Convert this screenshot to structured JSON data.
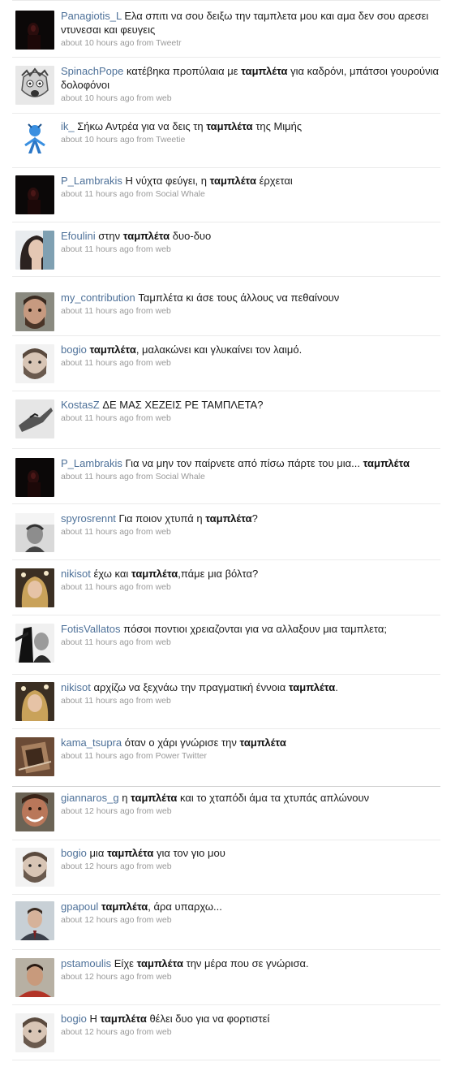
{
  "tweets": [
    {
      "user": "Panagiotis_L",
      "parts": [
        {
          "t": "Ελα σπιτι να σου δειξω την ταμπλετα μου και αμα δεν σου αρεσει ντυνεσαι και φευγεις",
          "b": false
        }
      ],
      "time": "about 10 hours ago",
      "source": "Tweetr",
      "avatar": "dark-figure-icon"
    },
    {
      "user": "SpinachPope",
      "parts": [
        {
          "t": "κατέβηκα προπύλαια με ",
          "b": false
        },
        {
          "t": "ταμπλέτα",
          "b": true
        },
        {
          "t": " για καδρόνι, μπάτσοι γουρούνια δολοφόνοι",
          "b": false
        }
      ],
      "time": "about 10 hours ago",
      "source": "web",
      "avatar": "cartoon-face-icon"
    },
    {
      "user": "ik_",
      "parts": [
        {
          "t": "Σήκω Αντρέα για να δεις τη ",
          "b": false
        },
        {
          "t": "ταμπλέτα",
          "b": true
        },
        {
          "t": " της Μιμής",
          "b": false
        }
      ],
      "time": "about 10 hours ago",
      "source": "Tweetie",
      "avatar": "blue-figure-icon"
    },
    {
      "user": "P_Lambrakis",
      "parts": [
        {
          "t": "Η νύχτα φεύγει, η ",
          "b": false
        },
        {
          "t": "ταμπλέτα",
          "b": true
        },
        {
          "t": " έρχεται",
          "b": false
        }
      ],
      "time": "about 11 hours ago",
      "source": "Social Whale",
      "avatar": "dark-figure-icon"
    },
    {
      "user": "Efoulini",
      "parts": [
        {
          "t": "στην ",
          "b": false
        },
        {
          "t": "ταμπλέτα",
          "b": true
        },
        {
          "t": " δυο-δυο",
          "b": false
        }
      ],
      "time": "about 11 hours ago",
      "source": "web",
      "avatar": "woman-portrait-icon"
    },
    {
      "user": "my_contribution",
      "parts": [
        {
          "t": "Ταμπλέτα κι άσε τους άλλους να πεθαίνουν",
          "b": false
        }
      ],
      "time": "about 11 hours ago",
      "source": "web",
      "avatar": "man-portrait-icon"
    },
    {
      "user": "bogio",
      "parts": [
        {
          "t": "ταμπλέτα",
          "b": true
        },
        {
          "t": ", μαλακώνει και γλυκαίνει τον λαιμό.",
          "b": false
        }
      ],
      "time": "about 11 hours ago",
      "source": "web",
      "avatar": "bearded-man-icon"
    },
    {
      "user": "KostasZ",
      "parts": [
        {
          "t": "ΔΕ ΜΑΣ ΧΕΖΕΙΣ ΡΕ ΤΑΜΠΛΕΤΑ?",
          "b": false
        }
      ],
      "time": "about 11 hours ago",
      "source": "web",
      "avatar": "hand-icon"
    },
    {
      "user": "P_Lambrakis",
      "parts": [
        {
          "t": "Για να μην τον παίρνετε από πίσω πάρτε του μια... ",
          "b": false
        },
        {
          "t": "ταμπλέτα",
          "b": true
        }
      ],
      "time": "about 11 hours ago",
      "source": "Social Whale",
      "avatar": "dark-figure-icon"
    },
    {
      "user": "spyrosrennt",
      "parts": [
        {
          "t": "Για ποιον χτυπά η ",
          "b": false
        },
        {
          "t": "ταμπλέτα",
          "b": true
        },
        {
          "t": "?",
          "b": false
        }
      ],
      "time": "about 11 hours ago",
      "source": "web",
      "avatar": "bw-portrait-icon"
    },
    {
      "user": "nikisot",
      "parts": [
        {
          "t": "έχω και ",
          "b": false
        },
        {
          "t": "ταμπλέτα",
          "b": true
        },
        {
          "t": ",πάμε μια βόλτα?",
          "b": false
        }
      ],
      "time": "about 11 hours ago",
      "source": "web",
      "avatar": "blonde-woman-icon"
    },
    {
      "user": "FotisVallatos",
      "parts": [
        {
          "t": "πόσοι ποντιοι χρειαζονται για να αλλαξουν μια ταμπλετα;",
          "b": false
        }
      ],
      "time": "about 11 hours ago",
      "source": "web",
      "avatar": "bw-man-icon"
    },
    {
      "user": "nikisot",
      "parts": [
        {
          "t": "αρχίζω να ξεχνάω την πραγματική έννοια ",
          "b": false
        },
        {
          "t": "ταμπλέτα",
          "b": true
        },
        {
          "t": ".",
          "b": false
        }
      ],
      "time": "about 11 hours ago",
      "source": "web",
      "avatar": "blonde-woman-icon"
    },
    {
      "user": "kama_tsupra",
      "parts": [
        {
          "t": "όταν ο χάρι γνώρισε την ",
          "b": false
        },
        {
          "t": "ταμπλέτα",
          "b": true
        }
      ],
      "time": "about 11 hours ago",
      "source": "Power Twitter",
      "avatar": "sepia-photo-icon"
    },
    {
      "user": "giannaros_g",
      "parts": [
        {
          "t": "η ",
          "b": false
        },
        {
          "t": "ταμπλέτα",
          "b": true
        },
        {
          "t": " και το χταπόδι άμα τα χτυπάς απλώνουν",
          "b": false
        }
      ],
      "time": "about 12 hours ago",
      "source": "web",
      "avatar": "smiling-man-icon"
    },
    {
      "user": "bogio",
      "parts": [
        {
          "t": "μια ",
          "b": false
        },
        {
          "t": "ταμπλέτα",
          "b": true
        },
        {
          "t": " για τον γιο μου",
          "b": false
        }
      ],
      "time": "about 12 hours ago",
      "source": "web",
      "avatar": "bearded-man-icon"
    },
    {
      "user": "gpapoul",
      "parts": [
        {
          "t": "ταμπλέτα",
          "b": true
        },
        {
          "t": ", άρα υπαρχω...",
          "b": false
        }
      ],
      "time": "about 12 hours ago",
      "source": "web",
      "avatar": "suit-man-icon"
    },
    {
      "user": "pstamoulis",
      "parts": [
        {
          "t": "Είχε ",
          "b": false
        },
        {
          "t": "ταμπλέτα",
          "b": true
        },
        {
          "t": " την μέρα που σε γνώρισα.",
          "b": false
        }
      ],
      "time": "about 12 hours ago",
      "source": "web",
      "avatar": "red-shirt-man-icon"
    },
    {
      "user": "bogio",
      "parts": [
        {
          "t": "Η ",
          "b": false
        },
        {
          "t": "ταμπλέτα",
          "b": true
        },
        {
          "t": " θέλει δυο για να φορτιστεί",
          "b": false
        }
      ],
      "time": "about 12 hours ago",
      "source": "web",
      "avatar": "bearded-man-icon"
    }
  ],
  "labels": {
    "from": "from"
  }
}
